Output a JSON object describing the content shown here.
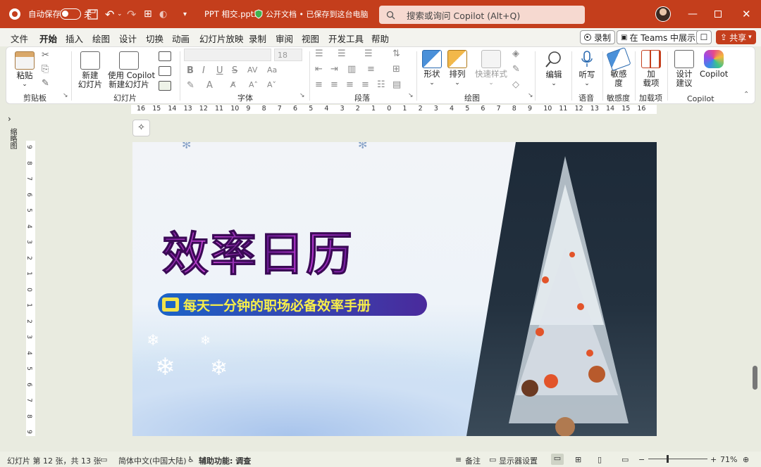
{
  "titlebar": {
    "autosave_label": "自动保存",
    "autosave_state": "关",
    "filename": "PPT 相交.pptx",
    "doc_status": "公开文档 • 已保存到这台电脑",
    "search_placeholder": "搜索或询问 Copilot (Alt+Q)",
    "accent": "#c43e1c"
  },
  "menu": {
    "tabs": [
      "文件",
      "开始",
      "插入",
      "绘图",
      "设计",
      "切换",
      "动画",
      "幻灯片放映",
      "录制",
      "审阅",
      "视图",
      "开发工具",
      "帮助"
    ],
    "active_tab": "开始",
    "record_label": "录制",
    "teams_label": "在 Teams 中展示",
    "share_label": "共享"
  },
  "ribbon": {
    "clipboard": {
      "paste": "粘贴",
      "group": "剪贴板"
    },
    "slides": {
      "new_slide": "新建",
      "new_slide2": "幻灯片",
      "copilot_slide": "使用 Copilot",
      "copilot_slide2": "新建幻灯片",
      "group": "幻灯片"
    },
    "font": {
      "size": "18",
      "group": "字体"
    },
    "paragraph": {
      "group": "段落"
    },
    "drawing": {
      "shapes": "形状",
      "arrange": "排列",
      "quick_styles": "快速样式",
      "group": "绘图"
    },
    "editing": {
      "edit": "编辑"
    },
    "voice": {
      "dictate": "听写",
      "group": "语音"
    },
    "sensitivity": {
      "label": "敏感",
      "label2": "度",
      "group": "敏感度"
    },
    "addins": {
      "label": "加",
      "label2": "载项",
      "group": "加载项"
    },
    "copilot": {
      "designer": "设计",
      "designer2": "建议",
      "copilot": "Copilot",
      "group": "Copilot"
    }
  },
  "left_panel": {
    "label": "缩略图"
  },
  "ruler": {
    "h_ticks": [
      "16",
      "15",
      "14",
      "13",
      "12",
      "11",
      "10",
      "9",
      "8",
      "7",
      "6",
      "5",
      "4",
      "3",
      "2",
      "1",
      "0",
      "1",
      "2",
      "3",
      "4",
      "5",
      "6",
      "7",
      "8",
      "9",
      "10",
      "11",
      "12",
      "13",
      "14",
      "15",
      "16"
    ],
    "v_ticks": [
      "9",
      "8",
      "7",
      "6",
      "5",
      "4",
      "3",
      "2",
      "1",
      "0",
      "1",
      "2",
      "3",
      "4",
      "5",
      "6",
      "7",
      "8",
      "9"
    ]
  },
  "slide": {
    "title": "效率日历",
    "subtitle": "每天一分钟的职场必备效率手册"
  },
  "status": {
    "slide_info": "幻灯片 第 12 张，共 13 张",
    "language": "简体中文(中国大陆)",
    "accessibility": "辅助功能: 调查",
    "notes": "备注",
    "display_settings": "显示器设置",
    "zoom": "71%"
  }
}
